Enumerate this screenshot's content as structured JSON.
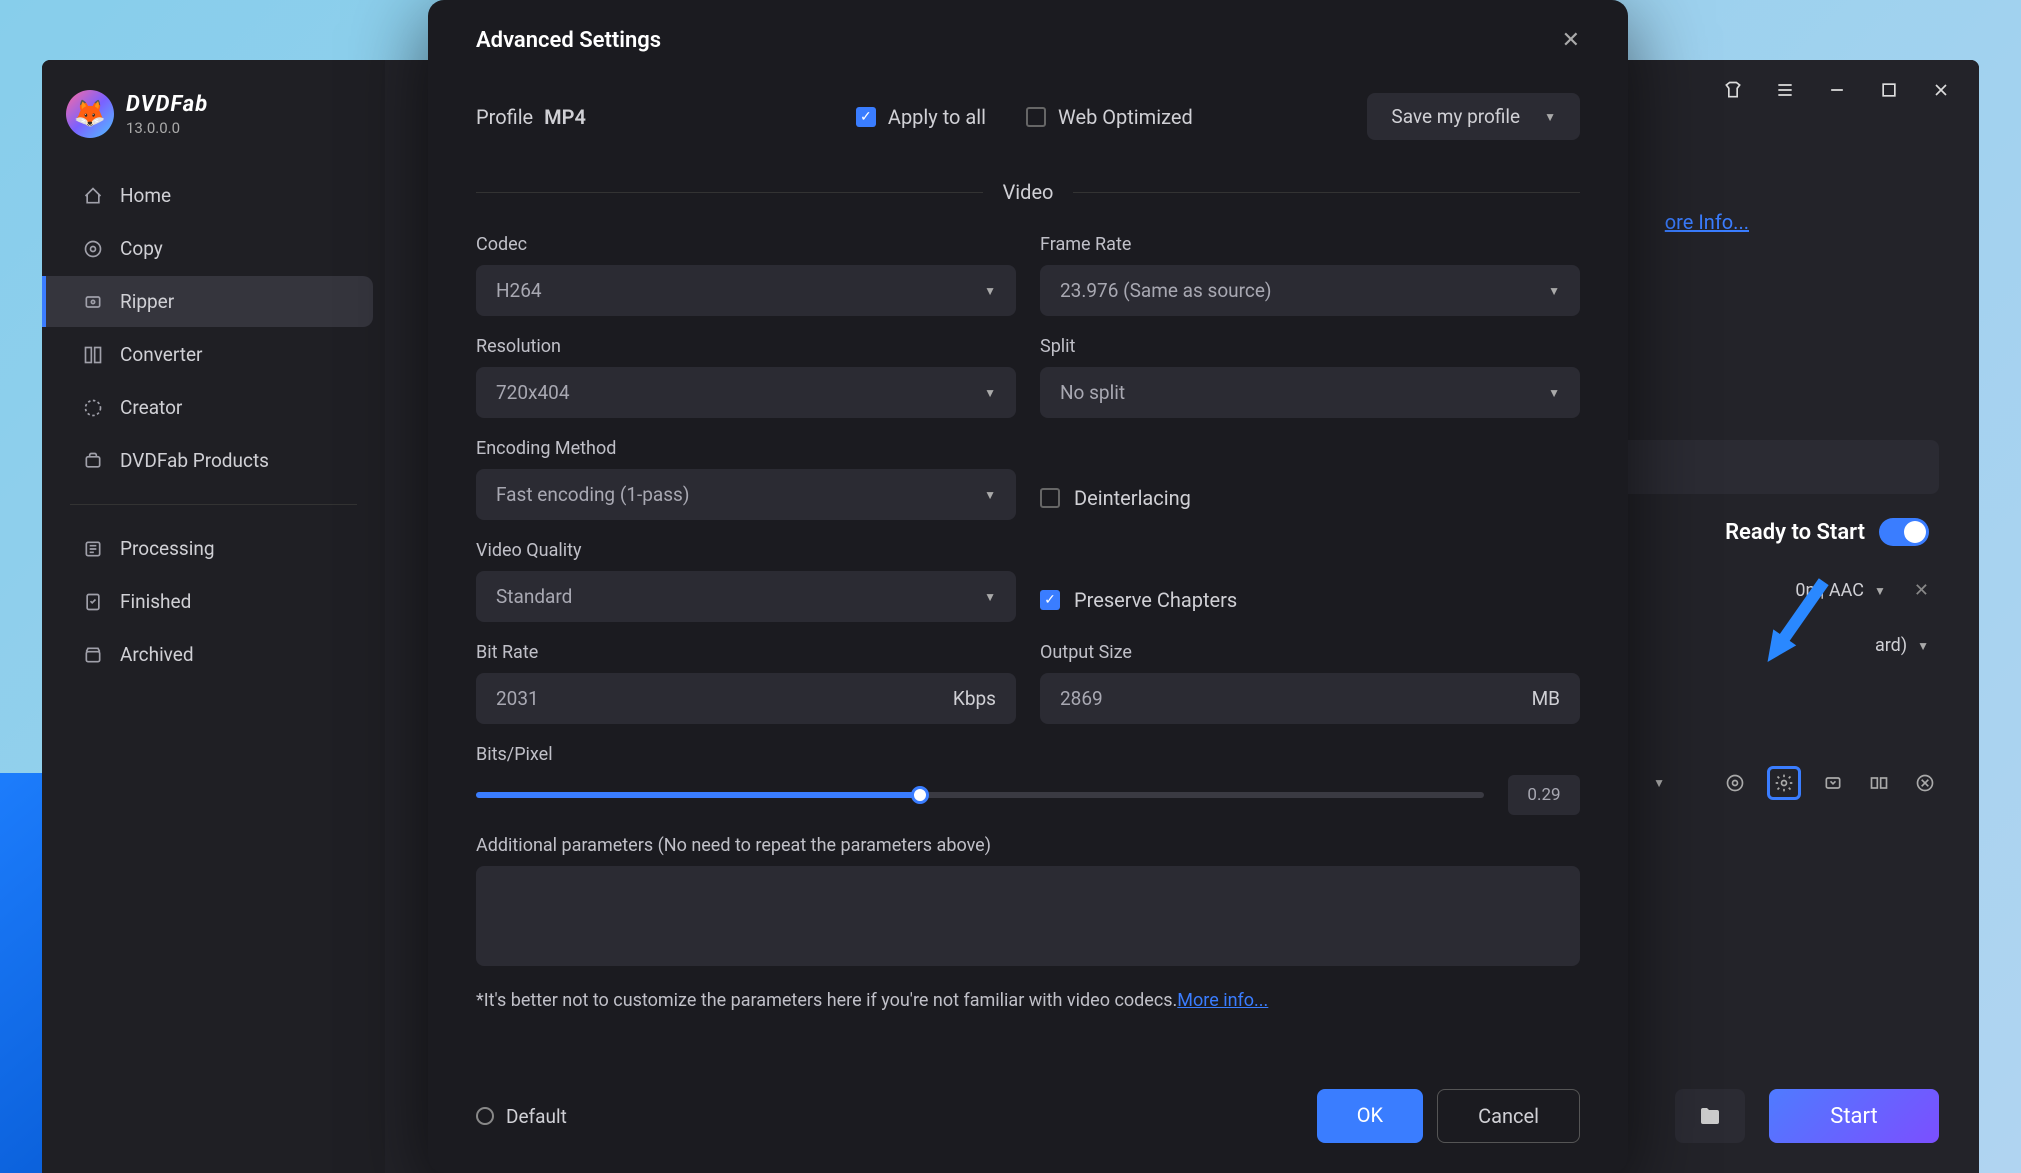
{
  "app": {
    "name": "DVDFab",
    "version": "13.0.0.0"
  },
  "sidebar": {
    "items": [
      {
        "label": "Home",
        "icon": "home"
      },
      {
        "label": "Copy",
        "icon": "copy"
      },
      {
        "label": "Ripper",
        "icon": "ripper",
        "active": true
      },
      {
        "label": "Converter",
        "icon": "converter"
      },
      {
        "label": "Creator",
        "icon": "creator"
      },
      {
        "label": "DVDFab Products",
        "icon": "products"
      }
    ],
    "items2": [
      {
        "label": "Processing",
        "icon": "processing"
      },
      {
        "label": "Finished",
        "icon": "finished"
      },
      {
        "label": "Archived",
        "icon": "archived"
      }
    ]
  },
  "titlebar": {},
  "content": {
    "more_info": "ore Info...",
    "ready_to_start": "Ready to Start",
    "format_text": "0p | AAC",
    "audio_text": "ard)",
    "start": "Start"
  },
  "modal": {
    "title": "Advanced Settings",
    "profile_label": "Profile",
    "profile_value": "MP4",
    "apply_to_all": "Apply to all",
    "web_optimized": "Web Optimized",
    "save_profile": "Save my profile",
    "section_video": "Video",
    "fields": {
      "codec": {
        "label": "Codec",
        "value": "H264"
      },
      "frame_rate": {
        "label": "Frame Rate",
        "value": "23.976 (Same as source)"
      },
      "resolution": {
        "label": "Resolution",
        "value": "720x404"
      },
      "split": {
        "label": "Split",
        "value": "No split"
      },
      "encoding": {
        "label": "Encoding Method",
        "value": "Fast encoding (1-pass)"
      },
      "deinterlacing": "Deinterlacing",
      "quality": {
        "label": "Video Quality",
        "value": "Standard"
      },
      "preserve_chapters": "Preserve Chapters",
      "bit_rate": {
        "label": "Bit Rate",
        "value": "2031",
        "unit": "Kbps"
      },
      "output_size": {
        "label": "Output Size",
        "value": "2869",
        "unit": "MB"
      },
      "bits_pixel": {
        "label": "Bits/Pixel",
        "value": "0.29",
        "percent": 44
      },
      "additional": {
        "label": "Additional parameters (No need to repeat the parameters above)",
        "value": ""
      }
    },
    "note": "*It's better not to customize the parameters here if you're not familiar with video codecs.",
    "more_info": "More info...",
    "default": "Default",
    "ok": "OK",
    "cancel": "Cancel"
  }
}
